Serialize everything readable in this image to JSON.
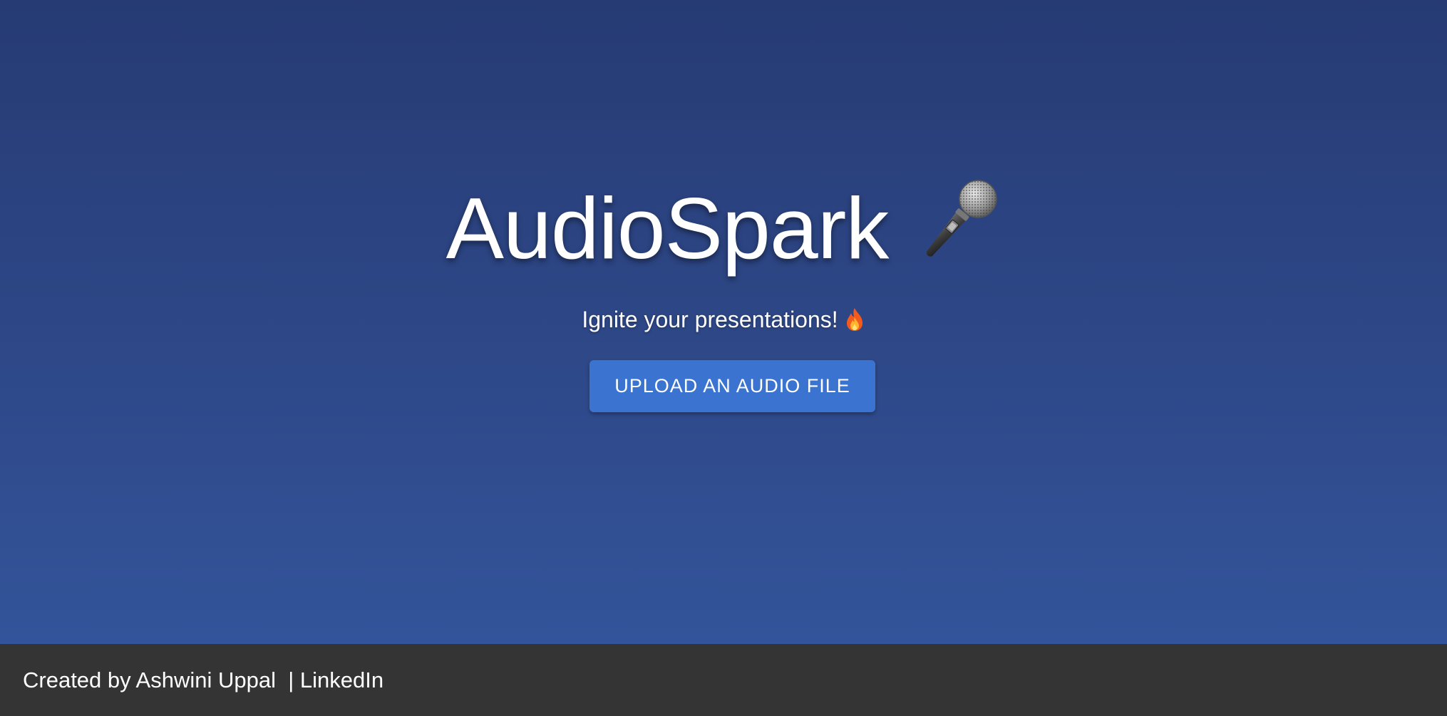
{
  "hero": {
    "title": "AudioSpark",
    "title_icon": "microphone-icon",
    "tagline": "Ignite your presentations!",
    "tagline_icon": "fire-icon",
    "upload_button_label": "UPLOAD AN AUDIO FILE"
  },
  "footer": {
    "created_by": "Created by Ashwini Uppal ",
    "separator": " | ",
    "linkedin_label": "LinkedIn"
  },
  "colors": {
    "background_top": "#263b74",
    "background_bottom": "#33549a",
    "button": "#3a74d0",
    "footer": "#343434",
    "text": "#ffffff"
  }
}
